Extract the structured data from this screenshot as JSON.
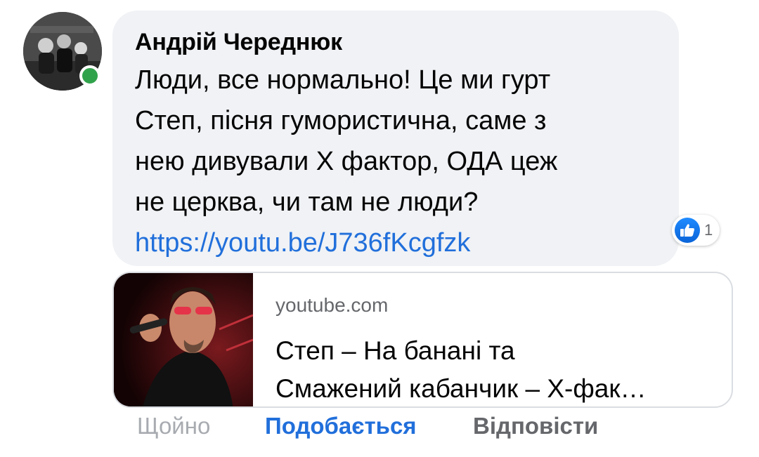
{
  "comment": {
    "author": "Андрій Череднюк",
    "text_lines": [
      "Люди, все нормально! Це ми гурт",
      "Степ, пісня гумористична, саме з",
      "нею дивували Х фактор, ОДА цеж",
      "не церква, чи там не люди?"
    ],
    "link": "https://youtu.be/J736fKcgfzk",
    "reaction_count": "1",
    "avatar_status": "online"
  },
  "preview": {
    "domain": "youtube.com",
    "title_line1": "Степ – На банані та",
    "title_line2": "Смажений кабанчик – Х-фак…"
  },
  "actions": {
    "time": "Щойно",
    "like": "Подобається",
    "reply": "Відповісти"
  },
  "colors": {
    "bubble": "#f0f2f5",
    "link": "#216fdb",
    "online": "#31a24c"
  }
}
